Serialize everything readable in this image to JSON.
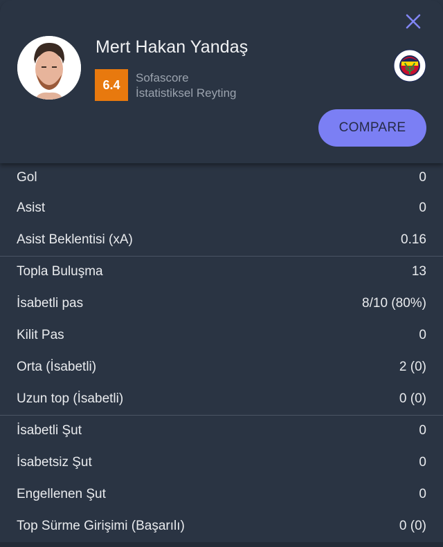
{
  "header": {
    "close_icon": "close-icon",
    "player_name": "Mert Hakan Yandaş",
    "rating": "6.4",
    "rating_color": "#e8790e",
    "rating_source": "Sofascore",
    "rating_label": "İstatistiksel Reyting",
    "team_logo": "fenerbahce-crest",
    "compare_label": "COMPARE",
    "accent_color": "#7b7ff4"
  },
  "stats": {
    "groups": [
      {
        "rows": [
          {
            "label": "Gol",
            "value": "0"
          },
          {
            "label": "Asist",
            "value": "0"
          },
          {
            "label": "Asist Beklentisi (xA)",
            "value": "0.16"
          }
        ]
      },
      {
        "rows": [
          {
            "label": "Topla Buluşma",
            "value": "13"
          },
          {
            "label": "İsabetli pas",
            "value": "8/10 (80%)"
          },
          {
            "label": "Kilit Pas",
            "value": "0"
          },
          {
            "label": "Orta (İsabetli)",
            "value": "2 (0)"
          },
          {
            "label": "Uzun top (İsabetli)",
            "value": "0 (0)"
          }
        ]
      },
      {
        "rows": [
          {
            "label": "İsabetli Şut",
            "value": "0"
          },
          {
            "label": "İsabetsiz Şut",
            "value": "0"
          },
          {
            "label": "Engellenen Şut",
            "value": "0"
          },
          {
            "label": "Top Sürme Girişimi (Başarılı)",
            "value": "0 (0)"
          }
        ]
      }
    ]
  }
}
